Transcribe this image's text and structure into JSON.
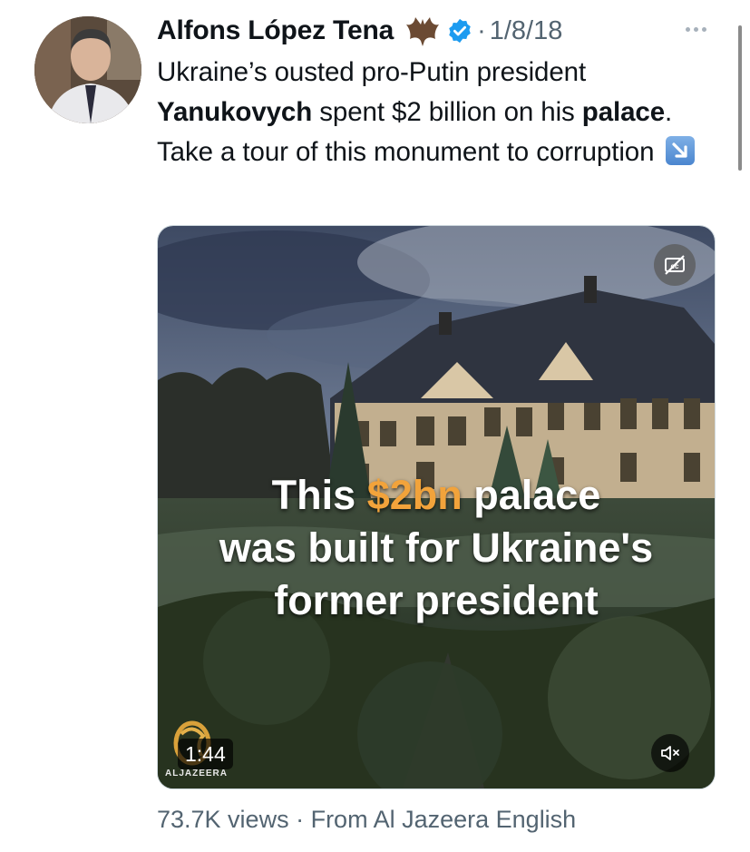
{
  "tweet": {
    "author_name": "Alfons López Tena",
    "separator": "·",
    "date": "1/8/18",
    "text": {
      "part1": "Ukraine’s ousted pro-Putin president ",
      "bold1": "Yanukovych",
      "part2": " spent $2 billion on his ",
      "bold2": "palace",
      "part3": ". Take a tour of this monument to corruption "
    },
    "icons": {
      "more": "more-horizontal-icon",
      "verified": "verified-badge-icon",
      "name_emoji": "bat-emoji-icon",
      "text_emoji": "arrow-down-right-emoji-icon"
    }
  },
  "video": {
    "caption_line1_a": "This ",
    "caption_line1_highlight": "$2bn",
    "caption_line1_b": " palace",
    "caption_line2": "was built for Ukraine's",
    "caption_line3": "former president",
    "duration": "1:44",
    "logo_text": "ALJAZEERA",
    "highlight_color": "#f2a33b",
    "icons": {
      "captions": "closed-captions-off-icon",
      "mute": "volume-muted-icon"
    }
  },
  "footer": {
    "views": "73.7K views",
    "separator": " · ",
    "source": "From Al Jazeera English"
  },
  "colors": {
    "text_primary": "#0f1419",
    "text_secondary": "#536471",
    "verified_blue": "#1d9bf0"
  }
}
